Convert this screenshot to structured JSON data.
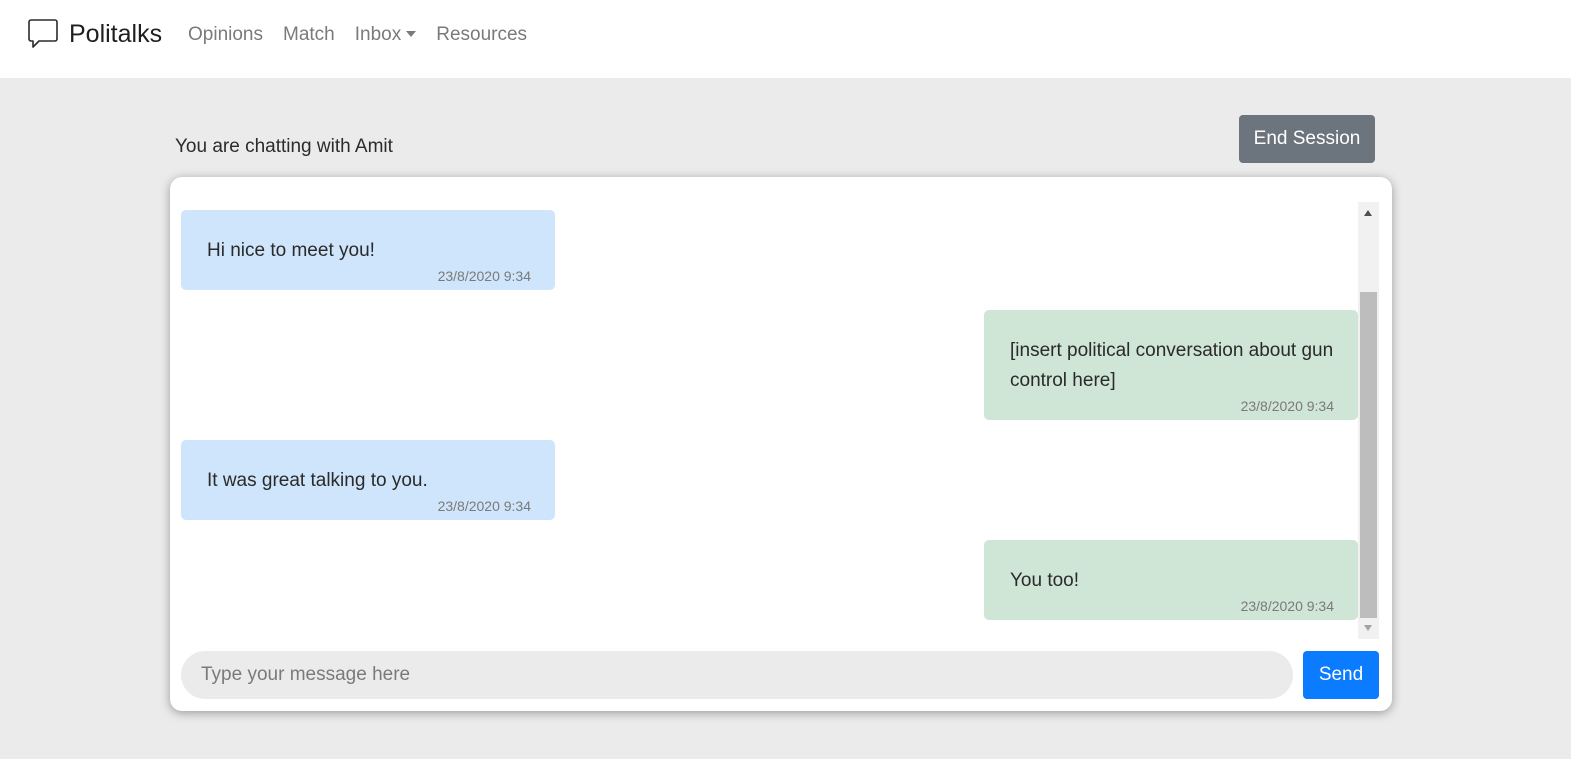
{
  "navbar": {
    "brand": "Politalks",
    "brand_icon": "chat-bubble-icon",
    "links": [
      {
        "label": "Opinions"
      },
      {
        "label": "Match"
      },
      {
        "label": "Inbox"
      },
      {
        "label": "Resources"
      }
    ]
  },
  "chat": {
    "header": "You are chatting with Amit",
    "end_session_label": "End Session",
    "messages": [
      {
        "direction": "received",
        "text": "Hi nice to meet you!",
        "time": "23/8/2020 9:34"
      },
      {
        "direction": "sent",
        "text": "[insert political conversation about gun control here]",
        "time": "23/8/2020 9:34"
      },
      {
        "direction": "received",
        "text": "It was great talking to you.",
        "time": "23/8/2020 9:34"
      },
      {
        "direction": "sent",
        "text": "You too!",
        "time": "23/8/2020 9:34"
      }
    ],
    "input_placeholder": "Type your message here",
    "send_label": "Send"
  },
  "colors": {
    "received_bubble": "#cfe5fb",
    "sent_bubble": "#cfe5d6",
    "primary": "#0b7bff",
    "secondary": "#6c757d",
    "page_background": "#ebebeb"
  }
}
